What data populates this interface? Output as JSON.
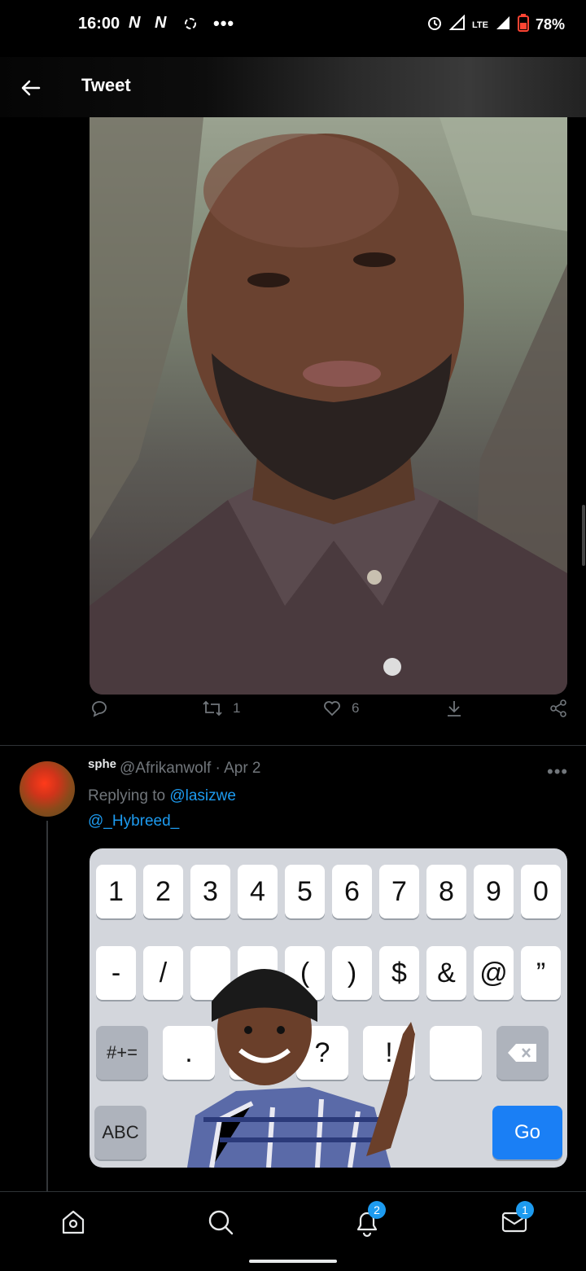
{
  "status_bar": {
    "time": "16:00",
    "notif_icons": [
      "N",
      "N"
    ],
    "battery": "78%",
    "network": "LTE"
  },
  "header": {
    "title": "Tweet"
  },
  "tweet1": {
    "retweets": "1",
    "likes": "6"
  },
  "reply": {
    "name": "sphe",
    "handle": "@Afrikanwolf",
    "date": "· Apr 2",
    "replying_prefix": "Replying to ",
    "replying_to": "@lasizwe",
    "mention": "@_Hybreed_",
    "keyboard": {
      "row1": [
        "1",
        "2",
        "3",
        "4",
        "5",
        "6",
        "7",
        "8",
        "9",
        "0"
      ],
      "row2": [
        "-",
        "/",
        "",
        "",
        "(",
        ")",
        "$",
        "&",
        "@",
        "”"
      ],
      "row3_left": "#+=",
      "row3": [
        ".",
        "",
        "?",
        "!",
        ""
      ],
      "row4_left": "ABC",
      "row4_go": "Go"
    }
  },
  "bottom_nav": {
    "notifications_badge": "2",
    "messages_badge": "1"
  }
}
